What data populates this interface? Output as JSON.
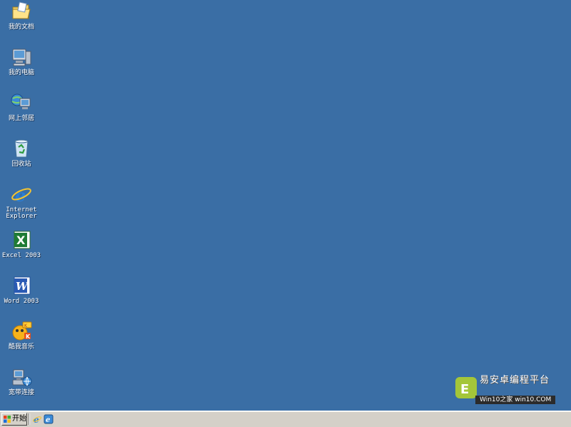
{
  "desktop": {
    "icons": [
      {
        "label": "我的文档",
        "icon": "folder-documents-icon"
      },
      {
        "label": "我的电脑",
        "icon": "computer-icon"
      },
      {
        "label": "网上邻居",
        "icon": "network-icon"
      },
      {
        "label": "回收站",
        "icon": "recycle-bin-icon"
      },
      {
        "label": "Internet\nExplorer",
        "icon": "internet-explorer-icon"
      },
      {
        "label": "Excel 2003",
        "icon": "excel-icon"
      },
      {
        "label": "Word 2003",
        "icon": "word-icon"
      },
      {
        "label": "酷我音乐",
        "icon": "kuwo-music-icon"
      },
      {
        "label": "宽带连接",
        "icon": "broadband-connection-icon"
      }
    ],
    "background_color": "#3a6ea5"
  },
  "taskbar": {
    "start_label": "开始",
    "quick_launch": [
      {
        "icon": "internet-explorer-icon"
      },
      {
        "icon": "show-desktop-icon"
      }
    ]
  },
  "watermark": {
    "title": "易安卓编程平台",
    "url": "Win10之家 win10.COM"
  }
}
